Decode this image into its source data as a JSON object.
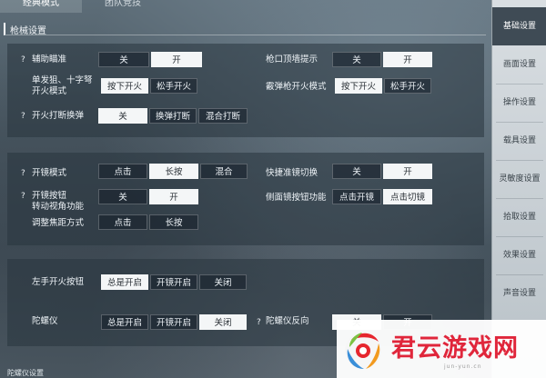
{
  "tabs": {
    "classic": "经典模式",
    "team": "团队竞技"
  },
  "section": {
    "title": "枪械设置"
  },
  "rows": {
    "aim_assist": {
      "help": "?",
      "label": "辅助瞄准",
      "options": [
        "关",
        "开"
      ],
      "selected": "开"
    },
    "muzzle_hint": {
      "label": "枪口顶墙提示",
      "options": [
        "关",
        "开"
      ],
      "selected": "开"
    },
    "single_fire": {
      "label_l1": "单发狙、十字弩",
      "label_l2": "开火模式",
      "options": [
        "按下开火",
        "松手开火"
      ],
      "selected": "按下开火"
    },
    "shotgun_fire": {
      "label": "霰弹枪开火模式",
      "options": [
        "按下开火",
        "松手开火"
      ],
      "selected": "按下开火"
    },
    "fire_interrupt": {
      "help": "?",
      "label": "开火打断换弹",
      "options": [
        "关",
        "换弹打断",
        "混合打断"
      ],
      "selected": "关"
    },
    "scope_mode": {
      "help": "?",
      "label": "开镜模式",
      "options": [
        "点击",
        "长按",
        "混合"
      ],
      "selected": "长按"
    },
    "quick_scope": {
      "label": "快捷准镜切换",
      "options": [
        "关",
        "开"
      ],
      "selected": "开"
    },
    "scope_btn": {
      "help": "?",
      "label_l1": "开镜按钮",
      "label_l2": "转动视角功能",
      "options": [
        "关",
        "开"
      ],
      "selected": "开"
    },
    "side_scope": {
      "label": "侧面镜按钮功能",
      "options": [
        "点击开镜",
        "点击切镜"
      ],
      "selected": "点击切镜"
    },
    "focus": {
      "label": "调整焦距方式",
      "options": [
        "点击",
        "长按"
      ],
      "selected": ""
    },
    "left_fire": {
      "label": "左手开火按钮",
      "options": [
        "总是开启",
        "开镜开启",
        "关闭"
      ],
      "selected": "总是开启"
    },
    "gyro": {
      "label": "陀螺仪",
      "options": [
        "总是开启",
        "开镜开启",
        "关闭"
      ],
      "selected": "关闭"
    },
    "gyro_reverse": {
      "help": "?",
      "label": "陀螺仪反向",
      "options": [
        "关",
        "开"
      ],
      "selected": "关"
    }
  },
  "sidebar": {
    "items": [
      "基础设置",
      "画面设置",
      "操作设置",
      "载具设置",
      "灵敏度设置",
      "拾取设置",
      "效果设置",
      "声音设置"
    ],
    "active": "基础设置"
  },
  "watermark": {
    "name": "君云游戏网",
    "sub": "jun-yun.cn"
  },
  "bottom_cut": "陀螺仪设置",
  "colors": {
    "selected_bg": "#f4f6f7",
    "sidebar_active": "#3f4b55",
    "watermark_red": "#e0263b"
  }
}
